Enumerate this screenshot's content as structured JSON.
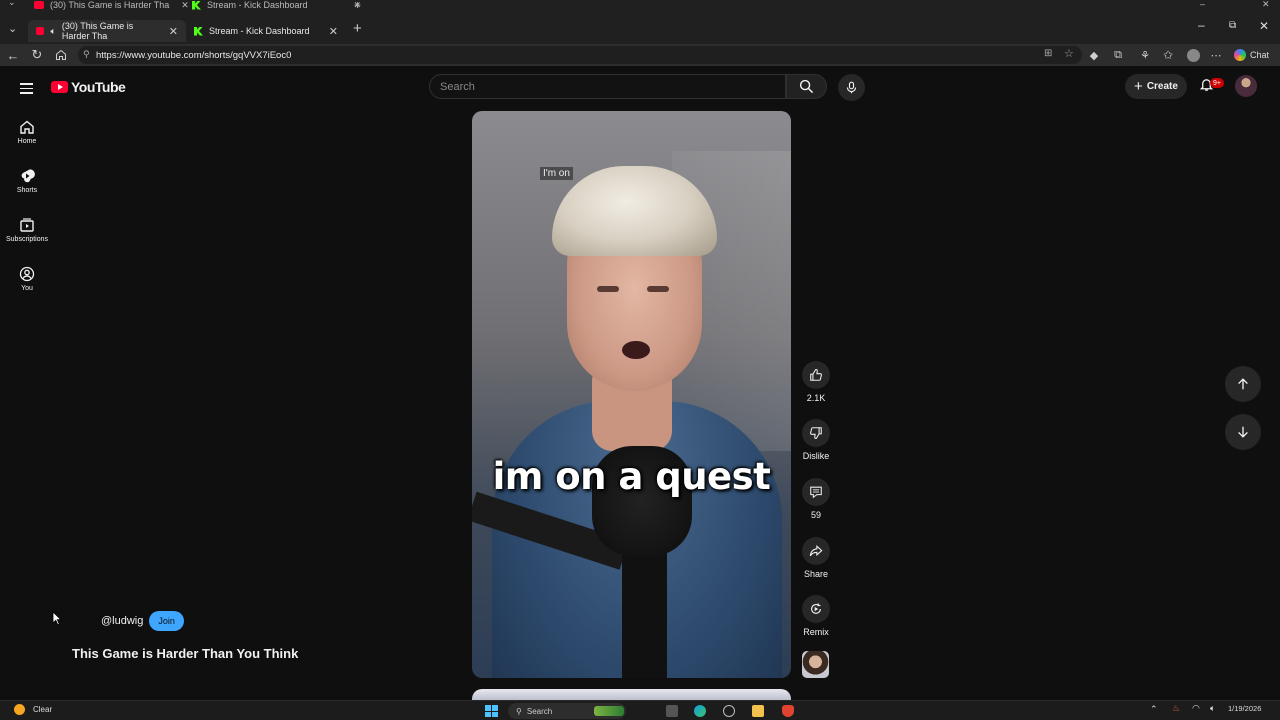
{
  "browser": {
    "ghost_tabs": [
      "(30) This Game is Harder Tha",
      "Stream - Kick Dashboard"
    ],
    "tabs": [
      {
        "label": "(30) This Game is Harder Tha",
        "active": true,
        "site": "youtube"
      },
      {
        "label": "Stream - Kick Dashboard",
        "active": false,
        "site": "kick"
      }
    ],
    "new_tab_icon": "plus-icon",
    "url": "https://www.youtube.com/shorts/gqVVX7iEoc0",
    "chat_label": "Chat"
  },
  "youtube": {
    "logo_text": "YouTube",
    "search_placeholder": "Search",
    "create_label": "Create",
    "notif_count": "9+",
    "sidebar": [
      {
        "label": "Home",
        "icon": "home-icon"
      },
      {
        "label": "Shorts",
        "icon": "shorts-icon"
      },
      {
        "label": "Subscriptions",
        "icon": "subscriptions-icon"
      },
      {
        "label": "You",
        "icon": "you-icon"
      }
    ],
    "short": {
      "caption_small": "I'm on",
      "caption_big": "im on a quest",
      "channel": "@ludwig",
      "join_label": "Join",
      "title": "This Game is Harder Than You Think"
    },
    "actions": {
      "like": "2.1K",
      "dislike": "Dislike",
      "comments": "59",
      "share": "Share",
      "remix": "Remix"
    }
  },
  "taskbar": {
    "weather": "Clear",
    "search": "Search",
    "date": "1/19/2026"
  },
  "colors": {
    "yt_red": "#ff0033",
    "join_blue": "#3ea6ff",
    "kick_green": "#53fc18"
  }
}
